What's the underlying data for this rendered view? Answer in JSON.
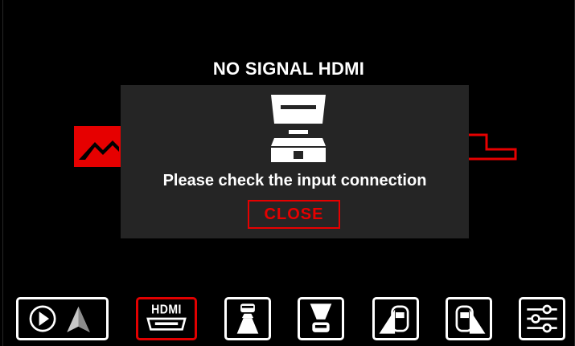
{
  "status": {
    "title": "NO SIGNAL HDMI"
  },
  "dialog": {
    "message": "Please check the input connection",
    "close_label": "CLOSE",
    "icon": "hdmi-connector-icon"
  },
  "dock": {
    "active": "hdmi",
    "hdmi_label": "HDMI",
    "items": [
      {
        "id": "carplay-android-auto",
        "icon": "play-and-navigation-icon"
      },
      {
        "id": "hdmi",
        "icon": "hdmi-icon"
      },
      {
        "id": "front-camera",
        "icon": "front-camera-icon"
      },
      {
        "id": "rear-camera",
        "icon": "rear-camera-icon"
      },
      {
        "id": "left-camera",
        "icon": "left-camera-icon"
      },
      {
        "id": "right-camera",
        "icon": "right-camera-icon"
      },
      {
        "id": "settings",
        "icon": "settings-sliders-icon"
      }
    ]
  },
  "colors": {
    "accent": "#e60000",
    "background": "#000000",
    "dialog": "#252525",
    "text": "#ffffff"
  }
}
